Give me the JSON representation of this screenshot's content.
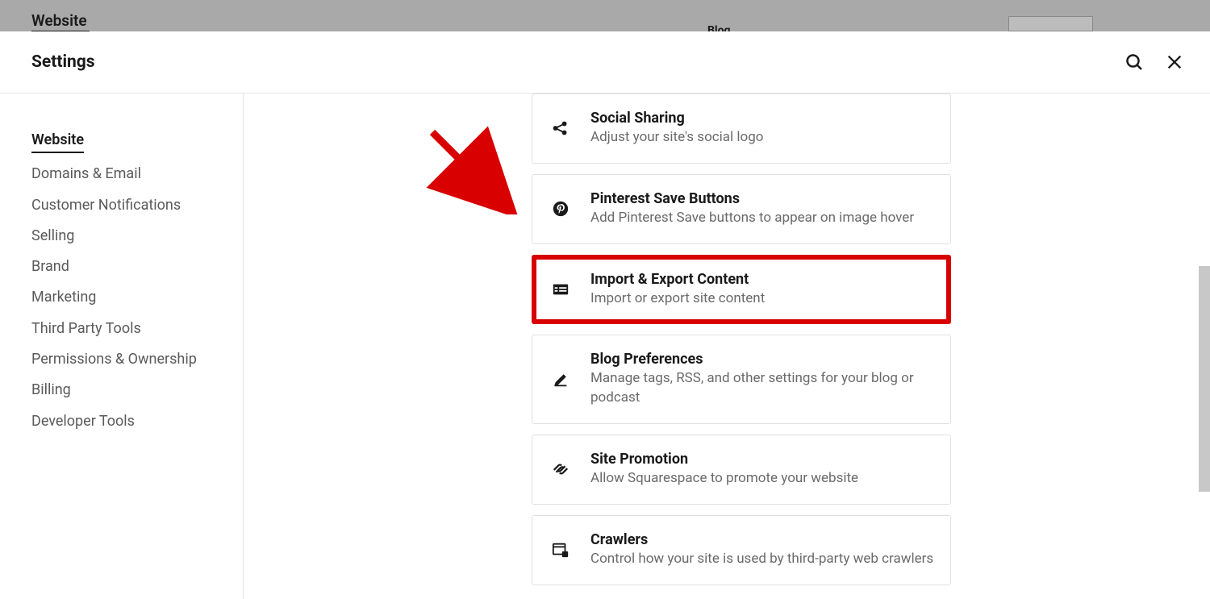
{
  "backdrop": {
    "tab_label": "Website",
    "blog_label": "Blog"
  },
  "header": {
    "title": "Settings"
  },
  "sidebar": {
    "items": [
      {
        "label": "Website",
        "active": true
      },
      {
        "label": "Domains & Email",
        "active": false
      },
      {
        "label": "Customer Notifications",
        "active": false
      },
      {
        "label": "Selling",
        "active": false
      },
      {
        "label": "Brand",
        "active": false
      },
      {
        "label": "Marketing",
        "active": false
      },
      {
        "label": "Third Party Tools",
        "active": false
      },
      {
        "label": "Permissions & Ownership",
        "active": false
      },
      {
        "label": "Billing",
        "active": false
      },
      {
        "label": "Developer Tools",
        "active": false
      }
    ]
  },
  "cards": [
    {
      "icon": "share-icon",
      "title": "Social Sharing",
      "desc": "Adjust your site's social logo",
      "highlighted": false
    },
    {
      "icon": "pinterest-icon",
      "title": "Pinterest Save Buttons",
      "desc": "Add Pinterest Save buttons to appear on image hover",
      "highlighted": false
    },
    {
      "icon": "spreadsheet-icon",
      "title": "Import & Export Content",
      "desc": "Import or export site content",
      "highlighted": true
    },
    {
      "icon": "pen-icon",
      "title": "Blog Preferences",
      "desc": "Manage tags, RSS, and other settings for your blog or podcast",
      "highlighted": false
    },
    {
      "icon": "squarespace-icon",
      "title": "Site Promotion",
      "desc": "Allow Squarespace to promote your website",
      "highlighted": false
    },
    {
      "icon": "crawler-icon",
      "title": "Crawlers",
      "desc": "Control how your site is used by third-party web crawlers",
      "highlighted": false
    }
  ],
  "colors": {
    "highlight": "#d80000"
  }
}
